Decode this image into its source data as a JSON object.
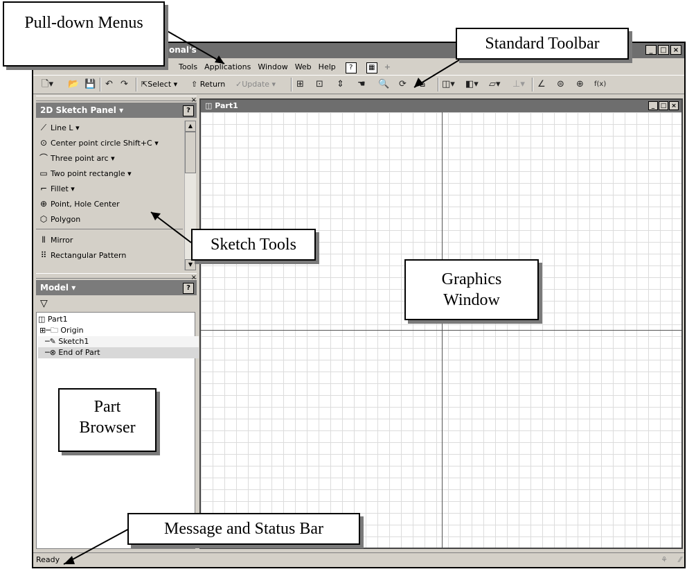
{
  "window": {
    "title": "onal's",
    "buttons": [
      "_",
      "□",
      "×"
    ]
  },
  "menubar": {
    "items": [
      "Tools",
      "Applications",
      "Window",
      "Web",
      "Help"
    ]
  },
  "toolbar": {
    "select_label": "Select",
    "return_label": "Return",
    "update_label": "Update"
  },
  "sketch_panel": {
    "title": "2D Sketch Panel",
    "items": [
      {
        "icon": "line-icon",
        "label": "Line   L"
      },
      {
        "icon": "center-circle-icon",
        "label": "Center point circle   Shift+C"
      },
      {
        "icon": "arc-icon",
        "label": "Three point arc"
      },
      {
        "icon": "rectangle-icon",
        "label": "Two point rectangle"
      },
      {
        "icon": "fillet-icon",
        "label": "Fillet"
      },
      {
        "icon": "point-icon",
        "label": "Point, Hole Center"
      },
      {
        "icon": "polygon-icon",
        "label": "Polygon"
      },
      {
        "icon": "mirror-icon",
        "label": "Mirror"
      },
      {
        "icon": "pattern-icon",
        "label": "Rectangular Pattern"
      }
    ]
  },
  "model_panel": {
    "title": "Model"
  },
  "browser": {
    "items": [
      "Part1",
      "Origin",
      "Sketch1",
      "End of Part"
    ]
  },
  "graphics": {
    "title": "Part1"
  },
  "status": {
    "text": "Ready"
  },
  "callouts": {
    "pulldown": "Pull-down Menus",
    "standard_toolbar": "Standard Toolbar",
    "sketch_tools": "Sketch Tools",
    "graphics_window": "Graphics Window",
    "part_browser": "Part Browser",
    "message_bar": "Message and Status Bar"
  }
}
